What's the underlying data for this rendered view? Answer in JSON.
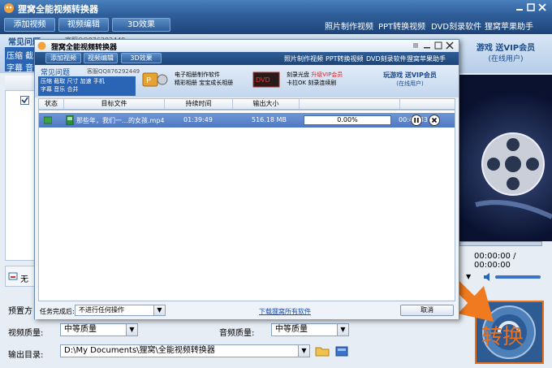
{
  "app": {
    "title": "狸窝全能视频转换器"
  },
  "toolbar": {
    "add_video": "添加视频",
    "edit_video": "视频编辑",
    "effect_3d": "3D效果"
  },
  "top_links": [
    "照片制作视频",
    "PPT转换视频",
    "DVD刻录软件",
    "狸窝苹果助手"
  ],
  "faq": {
    "title": "常见问题",
    "qq": "客服QQ876292449",
    "line1": "压缩 截",
    "line2": "字幕 音"
  },
  "vip_banner": {
    "line1": "游戏 送VIP会员",
    "line2": "(在线用户)"
  },
  "video": {
    "time": "00:00:00 / 00:00:00"
  },
  "left_panel": {
    "no_label": "无"
  },
  "settings": {
    "preset_label": "预置方",
    "video_quality_label": "视频质量:",
    "video_quality_value": "中等质量",
    "audio_quality_label": "音频质量:",
    "audio_quality_value": "中等质量",
    "output_label": "输出目录:",
    "output_value": "D:\\My Documents\\狸窝\\全能视频转换器"
  },
  "convert_button": {
    "label": "转换"
  },
  "dialog": {
    "title": "狸窝全能视频转换器",
    "toolbar": {
      "add_video": "添加视频",
      "edit_video": "视频编辑",
      "effect_3d": "3D效果"
    },
    "top_links": [
      "照片制作视频",
      "PPT转换视频",
      "DVD刻录软件",
      "狸窝苹果助手"
    ],
    "faq": {
      "title": "常见问题",
      "qq": "客服QQ876292449",
      "line1": "压缩 截取 尺寸 加速 手机",
      "line2": "字幕 音乐 合并"
    },
    "promo1": {
      "line1": "电子相册制作软件",
      "line2": "精彩相册 宝宝成长相册"
    },
    "promo2": {
      "line1": "刻录光盘",
      "hot": "升级VIP会员",
      "line2": "卡拉OK 刻录连续剧"
    },
    "promo3": {
      "line1": "玩游戏 送VIP会员",
      "line2": "(在线用户)"
    },
    "columns": [
      "状态",
      "目标文件",
      "持续时间",
      "输出大小",
      "",
      ""
    ],
    "rows": [
      {
        "file": "那些年，我们一…的女孩.mp4",
        "duration": "01:39:49",
        "size": "516.18 MB",
        "progress": "0.00%",
        "progress_value": 0,
        "remaining": "00:42:43"
      }
    ],
    "footer": {
      "after_label": "任务完成后:",
      "after_value": "不进行任何操作",
      "download_link": "下载狸窝所有软件",
      "cancel": "取消"
    }
  },
  "colors": {
    "accent": "#e8701c",
    "title_blue": "#2c5c98",
    "row_selected": "#5b83c8"
  }
}
